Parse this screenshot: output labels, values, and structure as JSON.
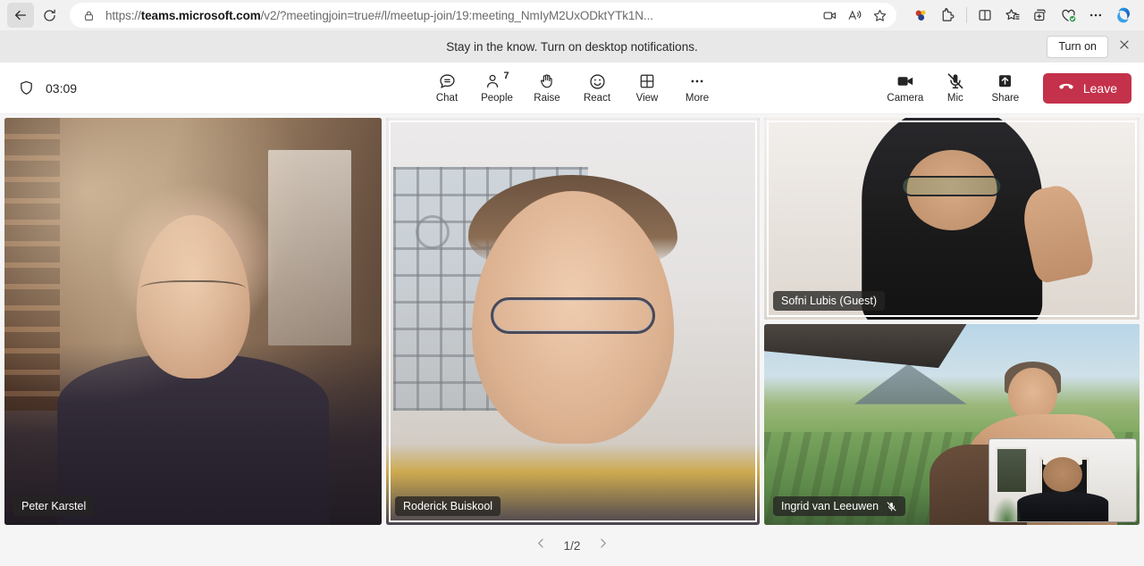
{
  "browser": {
    "back_icon": "back-arrow-icon",
    "reload_icon": "reload-icon",
    "lock_icon": "lock-icon",
    "url_prefix": "https://",
    "url_domain": "teams.microsoft.com",
    "url_suffix": "/v2/?meetingjoin=true#/l/meetup-join/19:meeting_NmIyM2UxODktYTk1N...",
    "url_full": "https://teams.microsoft.com/v2/?meetingjoin=true#/l/meetup-join/19:meeting_NmIyM2UxODktYTk1N...",
    "inline_icons": [
      {
        "name": "camera-video-icon"
      },
      {
        "name": "read-aloud-icon"
      },
      {
        "name": "favorite-star-icon"
      }
    ],
    "toolbar_icons": [
      {
        "name": "browser-essentials-spheres-icon"
      },
      {
        "name": "extensions-puzzle-icon"
      },
      {
        "name": "split-screen-icon"
      },
      {
        "name": "collections-icon"
      },
      {
        "name": "add-tab-group-icon"
      },
      {
        "name": "browser-performance-icon"
      },
      {
        "name": "settings-more-icon"
      },
      {
        "name": "copilot-icon"
      }
    ]
  },
  "notification": {
    "message": "Stay in the know. Turn on desktop notifications.",
    "turn_on_label": "Turn on",
    "close_icon": "close-icon"
  },
  "meeting_toolbar": {
    "shield_icon": "shield-icon",
    "timer": "03:09",
    "center_items": [
      {
        "label": "Chat",
        "icon": "chat-bubble-icon",
        "badge": ""
      },
      {
        "label": "People",
        "icon": "people-icon",
        "badge": "7"
      },
      {
        "label": "Raise",
        "icon": "raise-hand-icon",
        "badge": ""
      },
      {
        "label": "React",
        "icon": "react-smiley-icon",
        "badge": ""
      },
      {
        "label": "View",
        "icon": "view-grid-icon",
        "badge": ""
      },
      {
        "label": "More",
        "icon": "more-ellipsis-icon",
        "badge": ""
      }
    ],
    "right_items": [
      {
        "label": "Camera",
        "icon": "camera-on-icon"
      },
      {
        "label": "Mic",
        "icon": "mic-muted-icon"
      },
      {
        "label": "Share",
        "icon": "share-up-arrow-icon"
      }
    ],
    "leave_label": "Leave",
    "leave_icon": "hangup-phone-icon",
    "leave_color": "#c4314b"
  },
  "stage": {
    "active_border_color": "#5b5fc7",
    "participants": [
      {
        "name": "Peter Karstel",
        "speaking": false,
        "muted": false
      },
      {
        "name": "Roderick Buiskool",
        "speaking": true,
        "muted": false
      },
      {
        "name": "Sofni Lubis (Guest)",
        "speaking": true,
        "muted": false
      },
      {
        "name": "Ingrid van Leeuwen",
        "speaking": false,
        "muted": true,
        "mute_icon": "mic-muted-icon"
      }
    ],
    "self_view": {
      "name": "self-view-pip"
    }
  },
  "pager": {
    "prev_icon": "chevron-left-icon",
    "next_icon": "chevron-right-icon",
    "count": "1/2"
  }
}
